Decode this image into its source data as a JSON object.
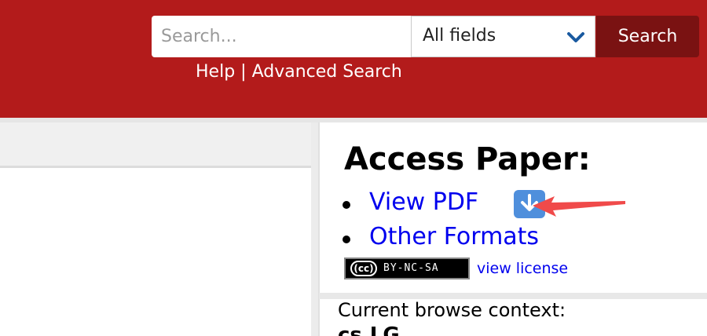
{
  "header": {
    "search_placeholder": "Search...",
    "field_select_value": "All fields",
    "search_button_label": "Search",
    "help_label": "Help",
    "separator": "|",
    "advanced_search_label": "Advanced Search",
    "brand_color": "#b31b1b"
  },
  "access": {
    "title": "Access Paper:",
    "items": [
      {
        "label": "View PDF",
        "icon": "download-icon"
      },
      {
        "label": "Other Formats"
      }
    ],
    "license_badge": "BY-NC-SA",
    "license_cc": "(cc)",
    "view_license_label": "view license",
    "annotation_color": "#f04a4a"
  },
  "browse": {
    "label": "Current browse context:",
    "value": "cs.LG"
  }
}
